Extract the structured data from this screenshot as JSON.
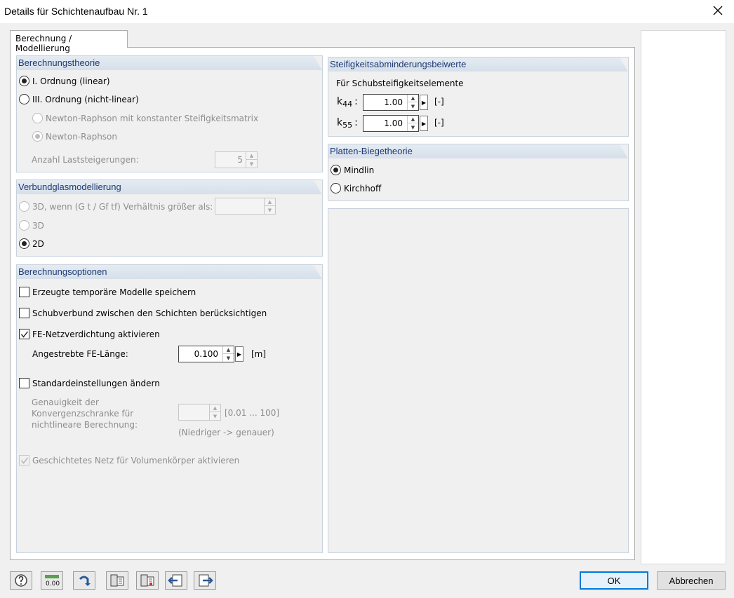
{
  "window": {
    "title": "Details für Schichtenaufbau Nr. 1"
  },
  "tabs": [
    {
      "label": "Berechnung / Modellierung"
    }
  ],
  "berechnungstheorie": {
    "title": "Berechnungstheorie",
    "linear": "I. Ordnung (linear)",
    "nonlinear": "III. Ordnung (nicht-linear)",
    "newton_const": "Newton-Raphson mit konstanter Steifigkeitsmatrix",
    "newton": "Newton-Raphson",
    "laststeigerungen_label": "Anzahl Laststeigerungen:",
    "laststeigerungen_value": "5"
  },
  "verbundglas": {
    "title": "Verbundglasmodellierung",
    "opt_3d_ratio": "3D, wenn (G t / Gf tf) Verhältnis größer als:",
    "opt_3d": "3D",
    "opt_2d": "2D",
    "ratio_value": ""
  },
  "optionen": {
    "title": "Berechnungsoptionen",
    "temp_models": "Erzeugte temporäre Modelle speichern",
    "schubverbund": "Schubverbund zwischen den Schichten berücksichtigen",
    "fe_netz": "FE-Netzverdichtung aktivieren",
    "fe_laenge_label": "Angestrebte FE-Länge:",
    "fe_laenge_value": "0.100",
    "fe_laenge_unit": "[m]",
    "standard": "Standardeinstellungen ändern",
    "genauigkeit_label_1": "Genauigkeit der",
    "genauigkeit_label_2": "Konvergenzschranke für",
    "genauigkeit_label_3": "nichtlineare Berechnung:",
    "genauigkeit_value": "",
    "genauigkeit_range": "[0.01 ... 100]",
    "genauigkeit_hint": "(Niedriger -> genauer)",
    "geschichtet": "Geschichtetes Netz für Volumenkörper aktivieren"
  },
  "steifigkeit": {
    "title": "Steifigkeitsabminderungsbeiwerte",
    "subtitle": "Für Schubsteifigkeitselemente",
    "k44_label": "k",
    "k44_sub": "44",
    "k44_value": "1.00",
    "k55_label": "k",
    "k55_sub": "55",
    "k55_value": "1.00",
    "unit": "[-]"
  },
  "platten": {
    "title": "Platten-Biegetheorie",
    "mindlin": "Mindlin",
    "kirchhoff": "Kirchhoff"
  },
  "footer": {
    "ok": "OK",
    "cancel": "Abbrechen"
  }
}
